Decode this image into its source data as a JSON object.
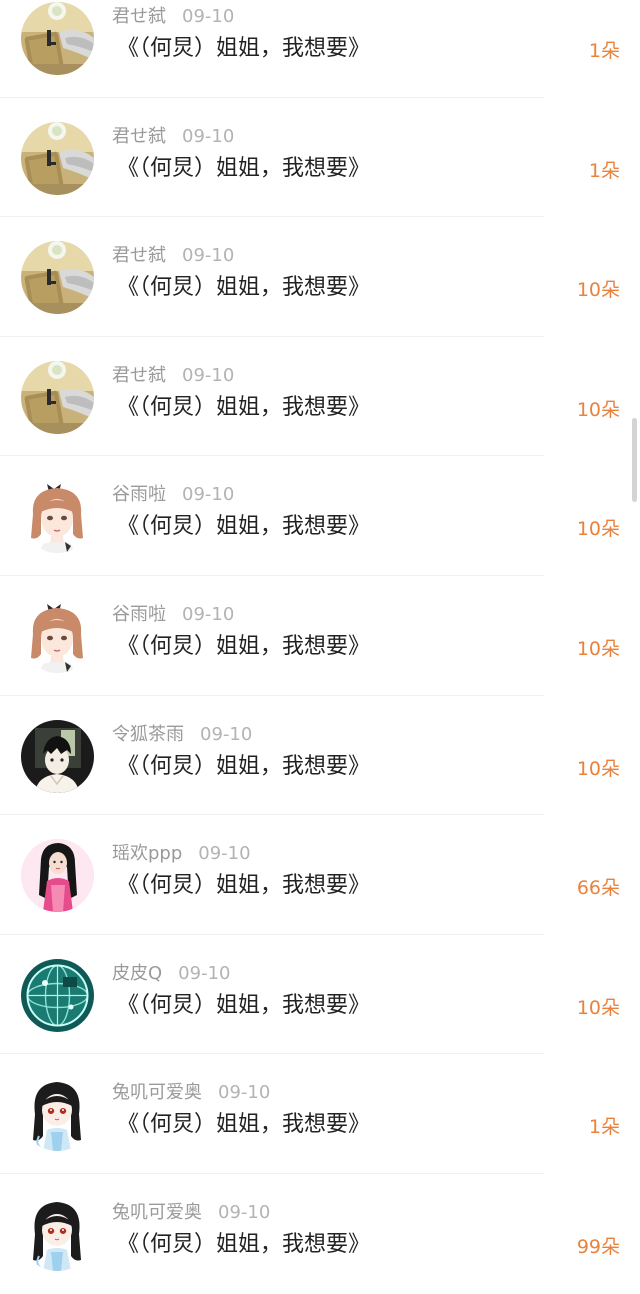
{
  "gift_records": [
    {
      "user": "君せ弑",
      "date": "09-10",
      "message": "《（何炅）姐姐，我想要》",
      "amount": "1朵",
      "avatar_icon": "photo-avatar-icon"
    },
    {
      "user": "君せ弑",
      "date": "09-10",
      "message": "《（何炅）姐姐，我想要》",
      "amount": "1朵",
      "avatar_icon": "photo-avatar-icon"
    },
    {
      "user": "君せ弑",
      "date": "09-10",
      "message": "《（何炅）姐姐，我想要》",
      "amount": "10朵",
      "avatar_icon": "photo-avatar-icon"
    },
    {
      "user": "君せ弑",
      "date": "09-10",
      "message": "《（何炅）姐姐，我想要》",
      "amount": "10朵",
      "avatar_icon": "photo-avatar-icon"
    },
    {
      "user": "谷雨啦",
      "date": "09-10",
      "message": "《（何炅）姐姐，我想要》",
      "amount": "10朵",
      "avatar_icon": "anime-girl-avatar-icon"
    },
    {
      "user": "谷雨啦",
      "date": "09-10",
      "message": "《（何炅）姐姐，我想要》",
      "amount": "10朵",
      "avatar_icon": "anime-girl-avatar-icon"
    },
    {
      "user": "令狐茶雨",
      "date": "09-10",
      "message": "《（何炅）姐姐，我想要》",
      "amount": "10朵",
      "avatar_icon": "anime-boy-avatar-icon"
    },
    {
      "user": "瑶欢ppp",
      "date": "09-10",
      "message": "《（何炅）姐姐，我想要》",
      "amount": "66朵",
      "avatar_icon": "girl-photo-avatar-icon"
    },
    {
      "user": "皮皮Q",
      "date": "09-10",
      "message": "《（何炅）姐姐，我想要》",
      "amount": "10朵",
      "avatar_icon": "globe-avatar-icon"
    },
    {
      "user": "兔叽可爱奥",
      "date": "09-10",
      "message": "《（何炅）姐姐，我想要》",
      "amount": "1朵",
      "avatar_icon": "chibi-girl-avatar-icon"
    },
    {
      "user": "兔叽可爱奥",
      "date": "09-10",
      "message": "《（何炅）姐姐，我想要》",
      "amount": "99朵",
      "avatar_icon": "chibi-girl-avatar-icon"
    }
  ],
  "colors": {
    "username": "#9a9a9a",
    "date": "#b3b3b3",
    "message": "#222222",
    "amount": "#e9823c",
    "divider": "#f0f0f0"
  }
}
